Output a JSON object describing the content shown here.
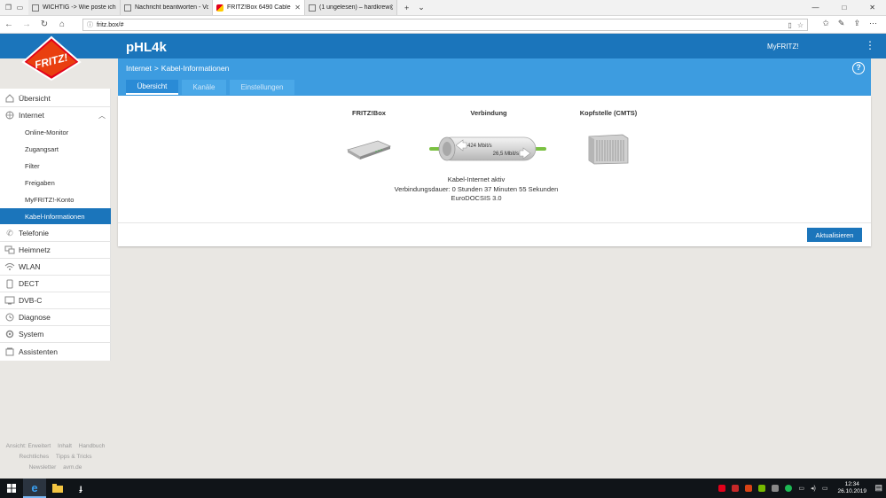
{
  "browser": {
    "tabs": [
      {
        "title": "WICHTIG -> Wie poste ich e",
        "active": false
      },
      {
        "title": "Nachricht beantworten - Vo",
        "active": false
      },
      {
        "title": "FRITZ!Box 6490 Cable",
        "active": true
      },
      {
        "title": "(1 ungelesen) – hardkrew@",
        "active": false
      }
    ],
    "url": "fritz.box/#"
  },
  "header": {
    "box_name": "pHL4k",
    "myfritz_label": "MyFRITZ!",
    "logo_text": "FRITZ!"
  },
  "breadcrumb": {
    "parent": "Internet",
    "separator": ">",
    "current": "Kabel-Informationen"
  },
  "content_tabs": [
    {
      "label": "Übersicht",
      "active": true
    },
    {
      "label": "Kanäle",
      "active": false
    },
    {
      "label": "Einstellungen",
      "active": false
    }
  ],
  "sidebar": {
    "items": [
      {
        "label": "Übersicht",
        "icon": "home-icon"
      },
      {
        "label": "Internet",
        "icon": "globe-icon",
        "expanded": true
      },
      {
        "label": "Online-Monitor",
        "sub": true
      },
      {
        "label": "Zugangsart",
        "sub": true
      },
      {
        "label": "Filter",
        "sub": true
      },
      {
        "label": "Freigaben",
        "sub": true
      },
      {
        "label": "MyFRITZ!-Konto",
        "sub": true
      },
      {
        "label": "Kabel-Informationen",
        "sub": true,
        "selected": true
      },
      {
        "label": "Telefonie",
        "icon": "phone-icon"
      },
      {
        "label": "Heimnetz",
        "icon": "network-icon"
      },
      {
        "label": "WLAN",
        "icon": "wifi-icon"
      },
      {
        "label": "DECT",
        "icon": "dect-icon"
      },
      {
        "label": "DVB-C",
        "icon": "tv-icon"
      },
      {
        "label": "Diagnose",
        "icon": "diagnose-icon"
      },
      {
        "label": "System",
        "icon": "system-icon"
      },
      {
        "label": "Assistenten",
        "icon": "wizard-icon"
      }
    ]
  },
  "footer": {
    "links": [
      "Ansicht: Erweitert",
      "Inhalt",
      "Handbuch",
      "Rechtliches",
      "Tipps & Tricks",
      "Newsletter",
      "avm.de"
    ]
  },
  "overview": {
    "col_fritzbox": "FRITZ!Box",
    "col_connection": "Verbindung",
    "col_cmts": "Kopfstelle (CMTS)",
    "downstream": "424 Mbit/s",
    "upstream": "26,5 Mbit/s",
    "status_line1": "Kabel-Internet aktiv",
    "status_line2": "Verbindungsdauer: 0 Stunden 37 Minuten 55 Sekunden",
    "status_line3": "EuroDOCSIS 3.0",
    "refresh_label": "Aktualisieren"
  },
  "taskbar": {
    "time": "12:34",
    "date": "26.10.2019"
  },
  "colors": {
    "brand_blue": "#1b75bb",
    "header_light_blue": "#3d9ce0",
    "green_indicator": "#7bc142"
  }
}
